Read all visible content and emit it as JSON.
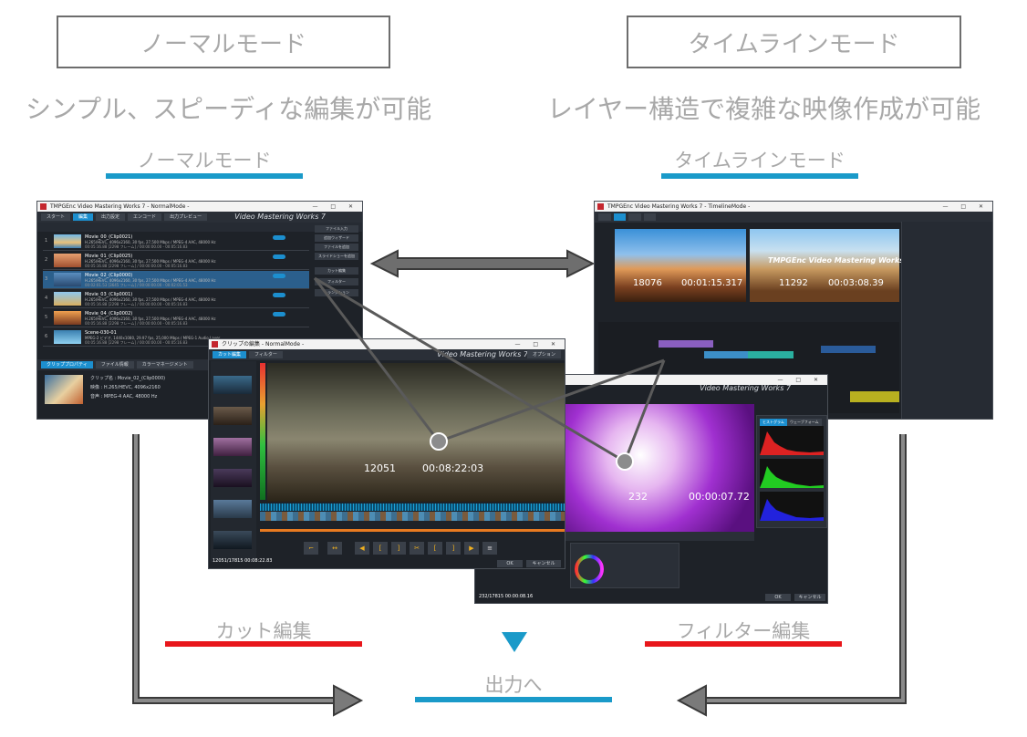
{
  "top": {
    "normal_mode_box": "ノーマルモード",
    "timeline_mode_box": "タイムラインモード",
    "normal_tagline": "シンプル、スピーディな編集が可能",
    "timeline_tagline": "レイヤー構造で複雑な映像作成が可能"
  },
  "labels": {
    "normal_mode": "ノーマルモード",
    "timeline_mode": "タイムラインモード",
    "cut_edit": "カット編集",
    "filter_edit": "フィルター編集",
    "output": "出力へ"
  },
  "colors": {
    "accent_blue": "#1a9ac9",
    "accent_red": "#e8161b",
    "arrow_gray": "#7a7a7a"
  },
  "normal_window": {
    "title": "TMPGEnc Video Mastering Works 7 - NormalMode -",
    "tabs": [
      "スタート",
      "編集",
      "出力設定",
      "エンコード",
      "出力プレビュー"
    ],
    "brand": "Video Mastering Works 7",
    "options": "オプション",
    "clips": [
      {
        "num": "1",
        "name": "Movie_00_(Clip0021)",
        "info": "H.265/HEVC, 4096x2160, 30 fps, 27,500 Mbps / MPEG-4 AAC, 48000 Hz",
        "time": "00:05:16.88 [2298 フレーム] / 00:00:00.00 - 00:05:16.83"
      },
      {
        "num": "2",
        "name": "Movie_01_(Clip0025)",
        "info": "H.265/HEVC, 4096x2160, 30 fps, 27,500 Mbps / MPEG-4 AAC, 48000 Hz",
        "time": "00:05:16.88 [2298 フレーム] / 00:00:00.00 - 00:05:16.83"
      },
      {
        "num": "3",
        "name": "Movie_02_(Clip0000)",
        "info": "H.265/HEVC, 4096x2160, 30 fps, 27,500 Mbps / MPEG-4 AAC, 48000 Hz",
        "time": "00:02:01.53 [3645 フレーム] / 00:00:00.00 - 00:02:01.53"
      },
      {
        "num": "4",
        "name": "Movie_03_(Clip0001)",
        "info": "H.265/HEVC, 4096x2160, 30 fps, 27,500 Mbps / MPEG-4 AAC, 48000 Hz",
        "time": "00:05:16.88 [2298 フレーム] / 00:00:00.00 - 00:05:16.83"
      },
      {
        "num": "5",
        "name": "Movie_04_(Clip0002)",
        "info": "H.265/HEVC, 4096x2160, 30 fps, 27,500 Mbps / MPEG-4 AAC, 48000 Hz",
        "time": "00:05:16.88 [2298 フレーム] / 00:00:00.00 - 00:05:16.83"
      },
      {
        "num": "6",
        "name": "Scene-030-01",
        "info": "MPEG-2 ビデオ, 1440x1080, 29.97 fps, 25,000 Mbps / MPEG-1 Audio Layer",
        "time": "00:05:16.88 [2298 フレーム] / 00:00:00.00 - 00:05:16.83"
      }
    ],
    "side_buttons": [
      "ファイル入力",
      "追加ウィザード",
      "ファイルを追加",
      "スライドショーを追加",
      "カット編集",
      "フィルター",
      "トランジション"
    ],
    "info_tabs": [
      "クリッププロパティ",
      "ファイル情報",
      "カラーマネージメント"
    ],
    "info_lines": [
      "クリップ名 : Movie_02_(Clip0000)",
      "映像 : H.265/HEVC, 4096x2160",
      "音声 : MPEG-4 AAC, 48000 Hz"
    ]
  },
  "cut_window": {
    "title": "クリップの編集 - NormalMode -",
    "tabs": [
      "カット編集",
      "フィルター"
    ],
    "brand": "Video Mastering Works 7",
    "options": "オプション",
    "frame": "12051",
    "timecode": "00:08:22:03",
    "status_frame": "12051/17815 00:08:22.83",
    "ok": "OK",
    "cancel": "キャンセル"
  },
  "timeline_window": {
    "title": "TMPGEnc Video Mastering Works 7 - TimelineMode -",
    "brand": "Video Mastering Works 7",
    "left_overlay_frame": "18076",
    "left_overlay_time": "00:01:15.317",
    "right_overlay_frame": "11292",
    "right_overlay_time": "00:03:08.39",
    "title_in_video": "TMPGEnc Video Mastering Works 7"
  },
  "filter_window": {
    "brand": "Video Mastering Works 7",
    "frame": "232",
    "timecode": "00:00:07.72",
    "status_frame": "232/17815 00:00:08.16",
    "ok": "OK",
    "cancel": "キャンセル",
    "scope_tabs": [
      "ヒストグラム",
      "ウェーブフォーム"
    ]
  }
}
